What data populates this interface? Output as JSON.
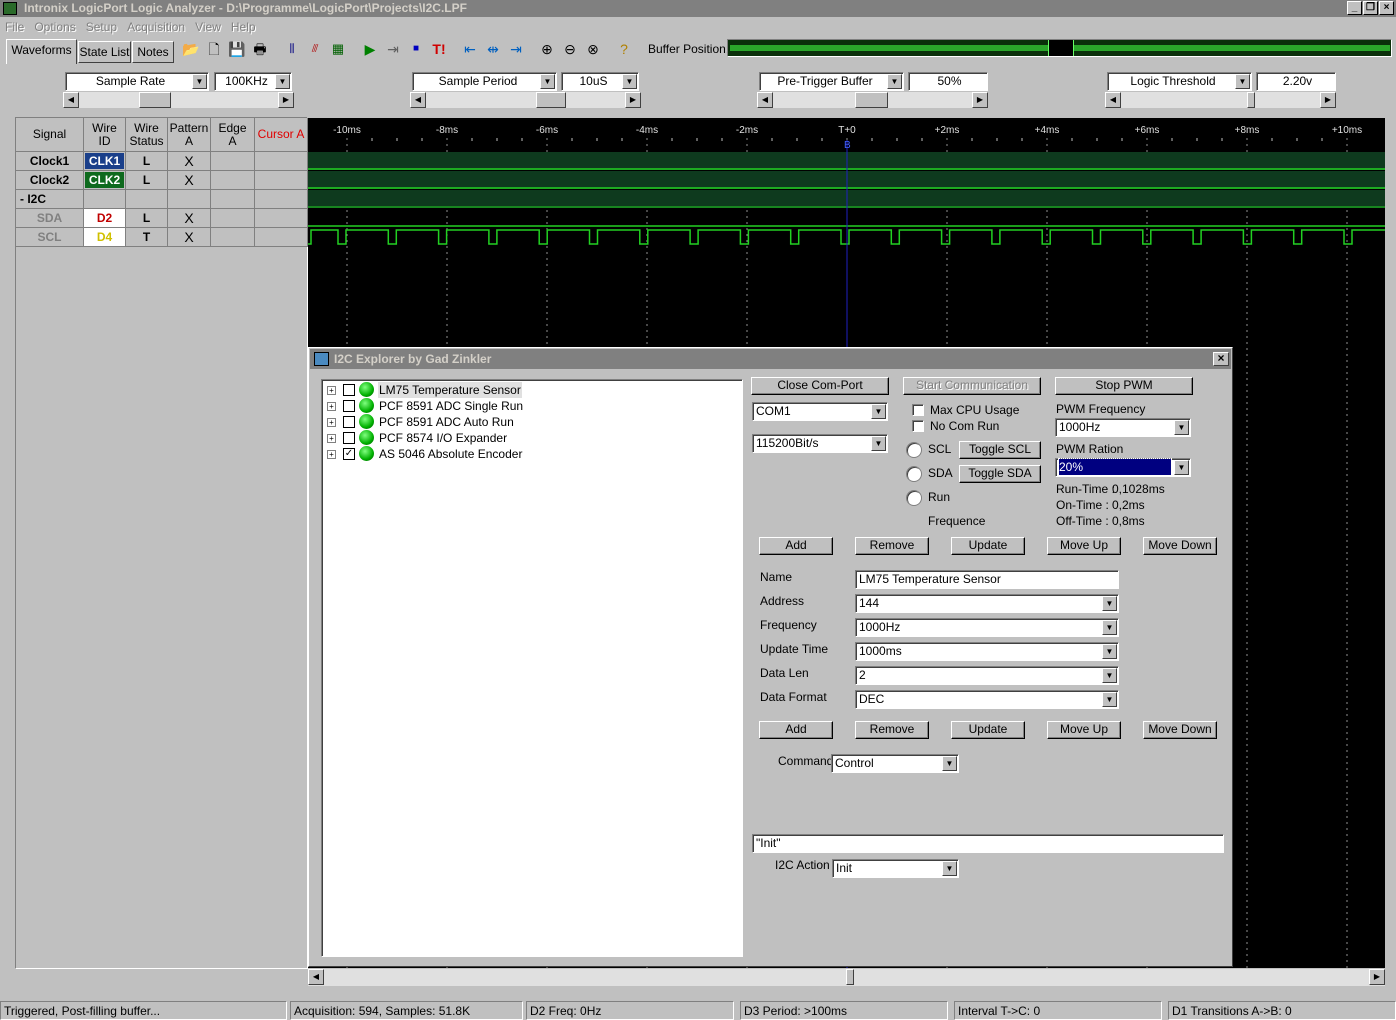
{
  "window": {
    "title": "Intronix LogicPort Logic Analyzer - D:\\Programme\\LogicPort\\Projects\\I2C.LPF"
  },
  "menu": [
    "File",
    "Options",
    "Setup",
    "Acquisition",
    "View",
    "Help"
  ],
  "tabs": [
    "Waveforms",
    "State List",
    "Notes"
  ],
  "toolbar": {
    "buffer_position_label": "Buffer Position:"
  },
  "settings": [
    {
      "label": "Sample Rate",
      "value": "100KHz"
    },
    {
      "label": "Sample Period",
      "value": "10uS"
    },
    {
      "label": "Pre-Trigger Buffer",
      "value": "50%"
    },
    {
      "label": "Logic Threshold",
      "value": "2.20v"
    }
  ],
  "signal_table": {
    "headers": {
      "signal": "Signal",
      "wire_id_1": "Wire",
      "wire_id_2": "ID",
      "wire_status_1": "Wire",
      "wire_status_2": "Status",
      "pattern_1": "Pattern",
      "pattern_2": "A",
      "edge_1": "Edge",
      "edge_2": "A",
      "cursor": "Cursor A"
    },
    "rows": [
      {
        "signal": "Clock1",
        "wire": "CLK1",
        "status": "L",
        "pattern": "X"
      },
      {
        "signal": "Clock2",
        "wire": "CLK2",
        "status": "L",
        "pattern": "X"
      },
      {
        "signal": "- I2C",
        "wire": "",
        "status": "",
        "pattern": ""
      },
      {
        "signal": "SDA",
        "wire": "D2",
        "status": "L",
        "pattern": "X"
      },
      {
        "signal": "SCL",
        "wire": "D4",
        "status": "T",
        "pattern": "X"
      }
    ]
  },
  "timeline": {
    "ticks": [
      "-10ms",
      "-8ms",
      "-6ms",
      "-4ms",
      "-2ms",
      "T+0",
      "+2ms",
      "+4ms",
      "+6ms",
      "+8ms",
      "+10ms"
    ],
    "cursor_label": "B"
  },
  "explorer": {
    "title": "I2C Explorer by Gad Zinkler",
    "devices": [
      {
        "name": "LM75 Temperature Sensor",
        "checked": false
      },
      {
        "name": "PCF 8591 ADC Single Run",
        "checked": false
      },
      {
        "name": "PCF 8591 ADC Auto Run",
        "checked": false
      },
      {
        "name": "PCF 8574 I/O Expander",
        "checked": false
      },
      {
        "name": "AS 5046 Absolute Encoder",
        "checked": true
      }
    ],
    "close_com_port": "Close Com-Port",
    "start_communication": "Start Communication",
    "stop_pwm": "Stop PWM",
    "com_port": "COM1",
    "baud_rate": "115200Bit/s",
    "max_cpu_usage": "Max CPU Usage",
    "no_com_run": "No Com Run",
    "scl": "SCL",
    "sda": "SDA",
    "run": "Run",
    "frequence": "Frequence",
    "toggle_scl": "Toggle SCL",
    "toggle_sda": "Toggle SDA",
    "pwm_frequency_label": "PWM Frequency",
    "pwm_frequency": "1000Hz",
    "pwm_ration_label": "PWM Ration",
    "pwm_ration": "20%",
    "run_time_label": "Run-Time :",
    "run_time": "0,1028ms",
    "on_time_label": "On-Time  :",
    "on_time": "0,2ms",
    "off_time_label": "Off-Time  :",
    "off_time": "0,8ms",
    "buttons": [
      "Add",
      "Remove",
      "Update",
      "Move Up",
      "Move Down"
    ],
    "form": {
      "name_label": "Name",
      "name": "LM75 Temperature Sensor",
      "address_label": "Address",
      "address": "144",
      "frequency_label": "Frequency",
      "frequency": "1000Hz",
      "update_time_label": "Update Time",
      "update_time": "1000ms",
      "data_len_label": "Data Len",
      "data_len": "2",
      "data_format_label": "Data Format",
      "data_format": "DEC"
    },
    "command_label": "Command",
    "command": "Control",
    "command_text": "\"Init\"",
    "i2c_action_label": "I2C Action",
    "i2c_action": "Init"
  },
  "status_bar": [
    "Triggered, Post-filling buffer...",
    "Acquisition: 594, Samples: 51.8K",
    "D2 Freq: 0Hz",
    "D3 Period: >100ms",
    "Interval T->C: 0",
    "D1 Transitions A->B: 0"
  ]
}
